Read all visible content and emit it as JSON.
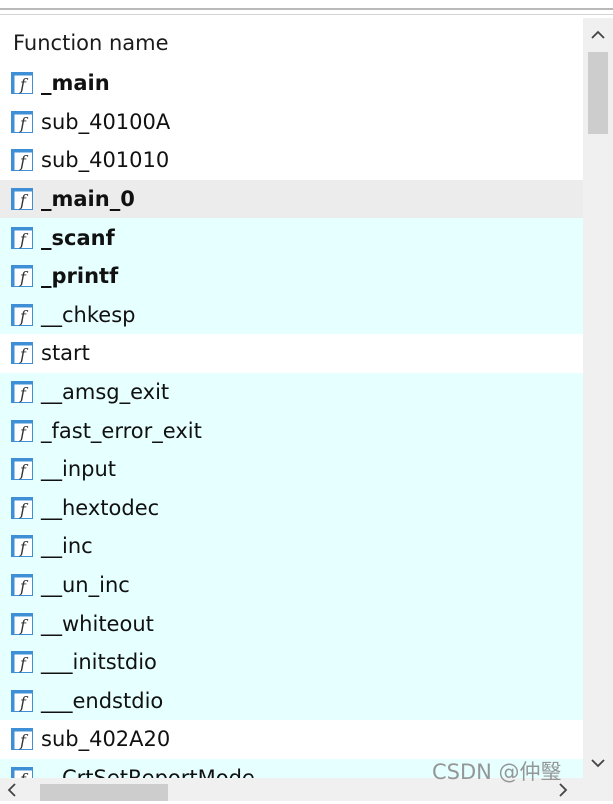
{
  "list": {
    "column_header": "Function name",
    "functions": [
      {
        "name": "_main",
        "bold": true,
        "row_style": "normal"
      },
      {
        "name": "sub_40100A",
        "bold": false,
        "row_style": "normal"
      },
      {
        "name": "sub_401010",
        "bold": false,
        "row_style": "normal"
      },
      {
        "name": "_main_0",
        "bold": true,
        "row_style": "selected"
      },
      {
        "name": "_scanf",
        "bold": true,
        "row_style": "library"
      },
      {
        "name": "_printf",
        "bold": true,
        "row_style": "library"
      },
      {
        "name": "__chkesp",
        "bold": false,
        "row_style": "library"
      },
      {
        "name": "start",
        "bold": false,
        "row_style": "normal"
      },
      {
        "name": "__amsg_exit",
        "bold": false,
        "row_style": "library"
      },
      {
        "name": "_fast_error_exit",
        "bold": false,
        "row_style": "library"
      },
      {
        "name": "__input",
        "bold": false,
        "row_style": "library"
      },
      {
        "name": "__hextodec",
        "bold": false,
        "row_style": "library"
      },
      {
        "name": "__inc",
        "bold": false,
        "row_style": "library"
      },
      {
        "name": "__un_inc",
        "bold": false,
        "row_style": "library"
      },
      {
        "name": "__whiteout",
        "bold": false,
        "row_style": "library"
      },
      {
        "name": "___initstdio",
        "bold": false,
        "row_style": "library"
      },
      {
        "name": "___endstdio",
        "bold": false,
        "row_style": "library"
      },
      {
        "name": "sub_402A20",
        "bold": false,
        "row_style": "normal"
      },
      {
        "name": "__CrtSetReportMode",
        "bold": false,
        "row_style": "library"
      }
    ]
  },
  "icons": {
    "function": "function-icon",
    "scroll_up": "chevron-up-icon",
    "scroll_down": "chevron-down-icon",
    "scroll_left": "chevron-left-icon",
    "scroll_right": "chevron-right-icon"
  },
  "colors": {
    "library_row_bg": "#e6ffff",
    "selected_row_bg": "#ececec",
    "icon_blue": "#3f8fd6"
  },
  "watermark": "CSDN @仲瑿"
}
